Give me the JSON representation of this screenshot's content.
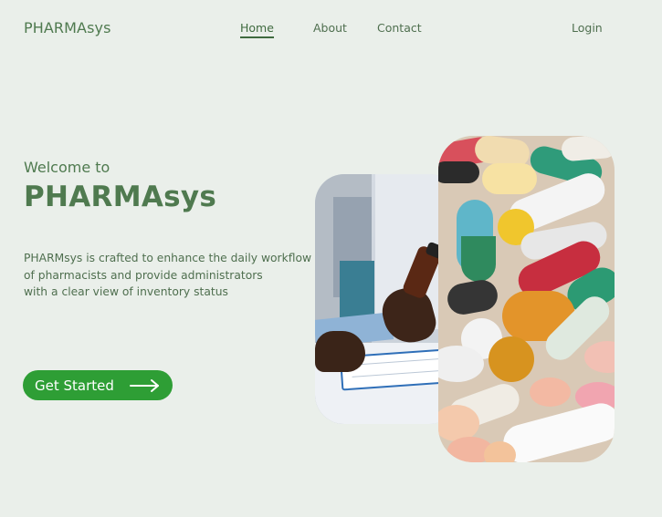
{
  "header": {
    "logo": "PHARMAsys",
    "nav": {
      "home": "Home",
      "about": "About",
      "contact": "Contact"
    },
    "login": "Login"
  },
  "hero": {
    "welcome": "Welcome to",
    "title": "PHARMAsys",
    "description_lines": [
      "PHARMsys is crafted to enhance the daily workflow",
      "of pharmacists and provide administrators",
      "with a clear view of inventory status"
    ],
    "cta_label": "Get Started",
    "cta_icon": "arrow-right-icon"
  },
  "images": {
    "pharmacist_photo": "pharmacist-holding-bottle-photo",
    "pills_photo": "assorted-pills-photo"
  },
  "colors": {
    "background": "#eaefea",
    "brand_green": "#4f7a4f",
    "cta_green": "#2e9e35"
  }
}
